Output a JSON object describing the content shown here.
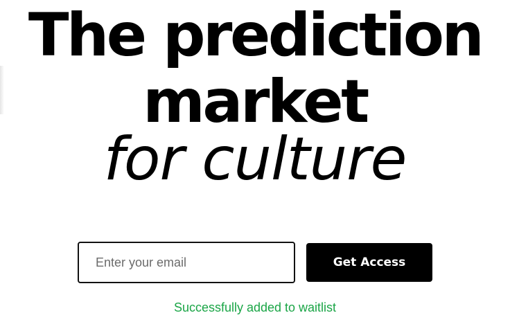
{
  "hero": {
    "line1": "The prediction",
    "line2": "market",
    "line3": "for culture"
  },
  "waitlist_form": {
    "email_placeholder": "Enter your email",
    "submit_label": "Get Access",
    "status_message": "Successfully added to waitlist",
    "status_color": "#1aa546"
  },
  "colors": {
    "text": "#000000",
    "background": "#ffffff",
    "button_background": "#000000",
    "button_text": "#ffffff"
  }
}
